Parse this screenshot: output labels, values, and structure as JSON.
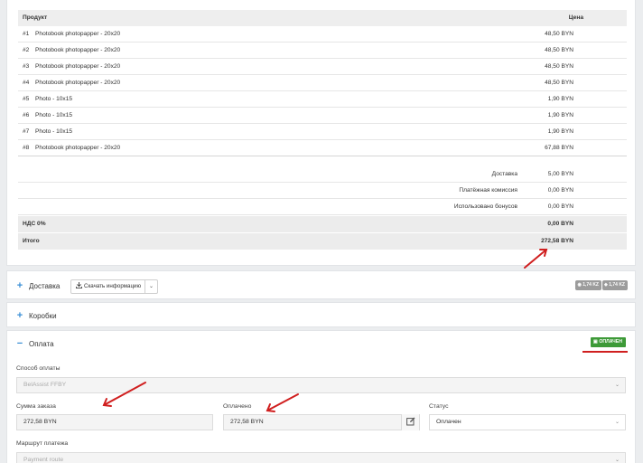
{
  "products_table": {
    "col_product": "Продукт",
    "col_price": "Цена",
    "items": [
      {
        "num": "#1",
        "name": "Photobook photopapper - 20x20",
        "price": "48,50 BYN"
      },
      {
        "num": "#2",
        "name": "Photobook photopapper - 20x20",
        "price": "48,50 BYN"
      },
      {
        "num": "#3",
        "name": "Photobook photopapper - 20x20",
        "price": "48,50 BYN"
      },
      {
        "num": "#4",
        "name": "Photobook photopapper - 20x20",
        "price": "48,50 BYN"
      },
      {
        "num": "#5",
        "name": "Photo - 10x15",
        "price": "1,90 BYN"
      },
      {
        "num": "#6",
        "name": "Photo - 10x15",
        "price": "1,90 BYN"
      },
      {
        "num": "#7",
        "name": "Photo - 10x15",
        "price": "1,90 BYN"
      },
      {
        "num": "#8",
        "name": "Photobook photopapper - 20x20",
        "price": "67,88 BYN"
      }
    ],
    "summary": [
      {
        "label": "Доставка",
        "value": "5,00 BYN"
      },
      {
        "label": "Платёжная комиссия",
        "value": "0,00 BYN"
      },
      {
        "label": "Использовано бонусов",
        "value": "0,00 BYN"
      }
    ],
    "vat_label": "НДС 0%",
    "vat_value": "0,00 BYN",
    "total_label": "Итого",
    "total_value": "272,58 BYN"
  },
  "delivery": {
    "title": "Доставка",
    "download_label": "Скачать информацию",
    "badge1": "1,74 KZ",
    "badge2": "1,74 KZ"
  },
  "boxes": {
    "title": "Коробки"
  },
  "payment": {
    "title": "Оплата",
    "status_badge": "ОПЛАЧЕН",
    "method_label": "Способ оплаты",
    "method_value": "BelAssist FFBY",
    "order_sum_label": "Сумма заказа",
    "order_sum_value": "272,58 BYN",
    "paid_label": "Оплачено",
    "paid_value": "272,58 BYN",
    "status_label": "Статус",
    "status_value": "Оплачен",
    "route_label": "Маршрут платежа",
    "route_placeholder": "Payment route"
  },
  "colors": {
    "accent_blue": "#3a8fd6",
    "paid_green": "#3d9a38",
    "annotation_red": "#d01f1f"
  }
}
